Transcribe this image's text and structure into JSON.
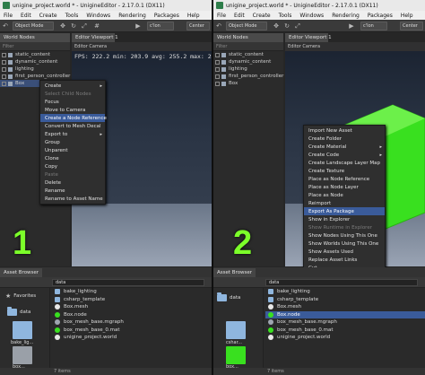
{
  "window": {
    "title": "unigine_project.world * - UnigineEditor - 2.17.0.1 (DX11)"
  },
  "menu": [
    "File",
    "Edit",
    "Create",
    "Tools",
    "Windows",
    "Rendering",
    "Packages",
    "Help"
  ],
  "toolbar": {
    "mode": "Object Mode",
    "camera_button": "c'Ion",
    "center": "Center",
    "rendering": "dering Def"
  },
  "panels": {
    "world_nodes": "World Nodes",
    "editor_viewport": "Editor Viewport 1",
    "editor_camera": "Editor Camera",
    "filter_placeholder": "Filter"
  },
  "nodes": [
    "static_content",
    "dynamic_content",
    "lighting",
    "first_person_controller",
    "Box"
  ],
  "viewport": {
    "fps_line": "FPS: 222.2  min: 203.9  avg: 255.2  max: 268."
  },
  "labels": {
    "pane1_number": "1",
    "pane2_number": "2"
  },
  "menu1": {
    "items": [
      {
        "label": "Create",
        "submenu": true,
        "disabled": false
      },
      {
        "label": "Select Child Nodes",
        "disabled": true
      },
      {
        "label": "Focus",
        "disabled": false
      },
      {
        "label": "Move to Camera",
        "disabled": false
      },
      {
        "label": "Create a Node Reference",
        "disabled": false,
        "highlight": true
      },
      {
        "label": "Convert to Mesh Decal",
        "disabled": false
      },
      {
        "label": "Export to",
        "submenu": true,
        "disabled": false
      },
      {
        "label": "Group",
        "disabled": false
      },
      {
        "label": "Unparent",
        "disabled": false
      },
      {
        "label": "Clone",
        "disabled": false
      },
      {
        "label": "Copy",
        "disabled": false
      },
      {
        "label": "Paste",
        "disabled": true
      },
      {
        "label": "Delete",
        "disabled": false
      },
      {
        "label": "Rename",
        "disabled": false
      },
      {
        "label": "Rename to Asset Name",
        "disabled": false
      }
    ]
  },
  "menu2": {
    "items": [
      {
        "label": "Import New Asset"
      },
      {
        "label": "Create Folder"
      },
      {
        "label": "Create Material",
        "submenu": true
      },
      {
        "label": "Create Code",
        "submenu": true
      },
      {
        "label": "Create Landscape Layer Map"
      },
      {
        "label": "Create Texture"
      },
      {
        "label": "Place as Node Reference"
      },
      {
        "label": "Place as Node Layer"
      },
      {
        "label": "Place as Node"
      },
      {
        "label": "Reimport"
      },
      {
        "label": "Export As Package",
        "highlight": true
      },
      {
        "label": "Show in Explorer"
      },
      {
        "label": "Show Runtime in Explorer",
        "disabled": true
      },
      {
        "label": "Show Nodes Using This One"
      },
      {
        "label": "Show Worlds Using This One"
      },
      {
        "label": "Show Assets Used"
      },
      {
        "label": "Replace Asset Links"
      },
      {
        "label": "Cut"
      },
      {
        "label": "Copy"
      },
      {
        "label": "Paste",
        "disabled": true
      },
      {
        "label": "Rename"
      },
      {
        "label": "Delete"
      },
      {
        "label": "Add To Favorites"
      }
    ]
  },
  "asset_browser": {
    "tab": "Asset Browser",
    "path": "data",
    "favorites": "Favorites",
    "root_folder": "data",
    "files": [
      "bake_lighting",
      "csharp_template",
      "Box.mesh",
      "Box.node",
      "box_mesh_base.mgraph",
      "box_mesh_base_0.mat",
      "unigine_project.world"
    ],
    "thumbs": [
      "bake_lig...",
      "cshar...",
      "box..."
    ],
    "status_pane1": "7 items",
    "status_pane2": "7 items"
  },
  "colors": {
    "accent": "#3a5b9a",
    "green_number": "#7cff2a",
    "box_green": "#39e01f"
  }
}
